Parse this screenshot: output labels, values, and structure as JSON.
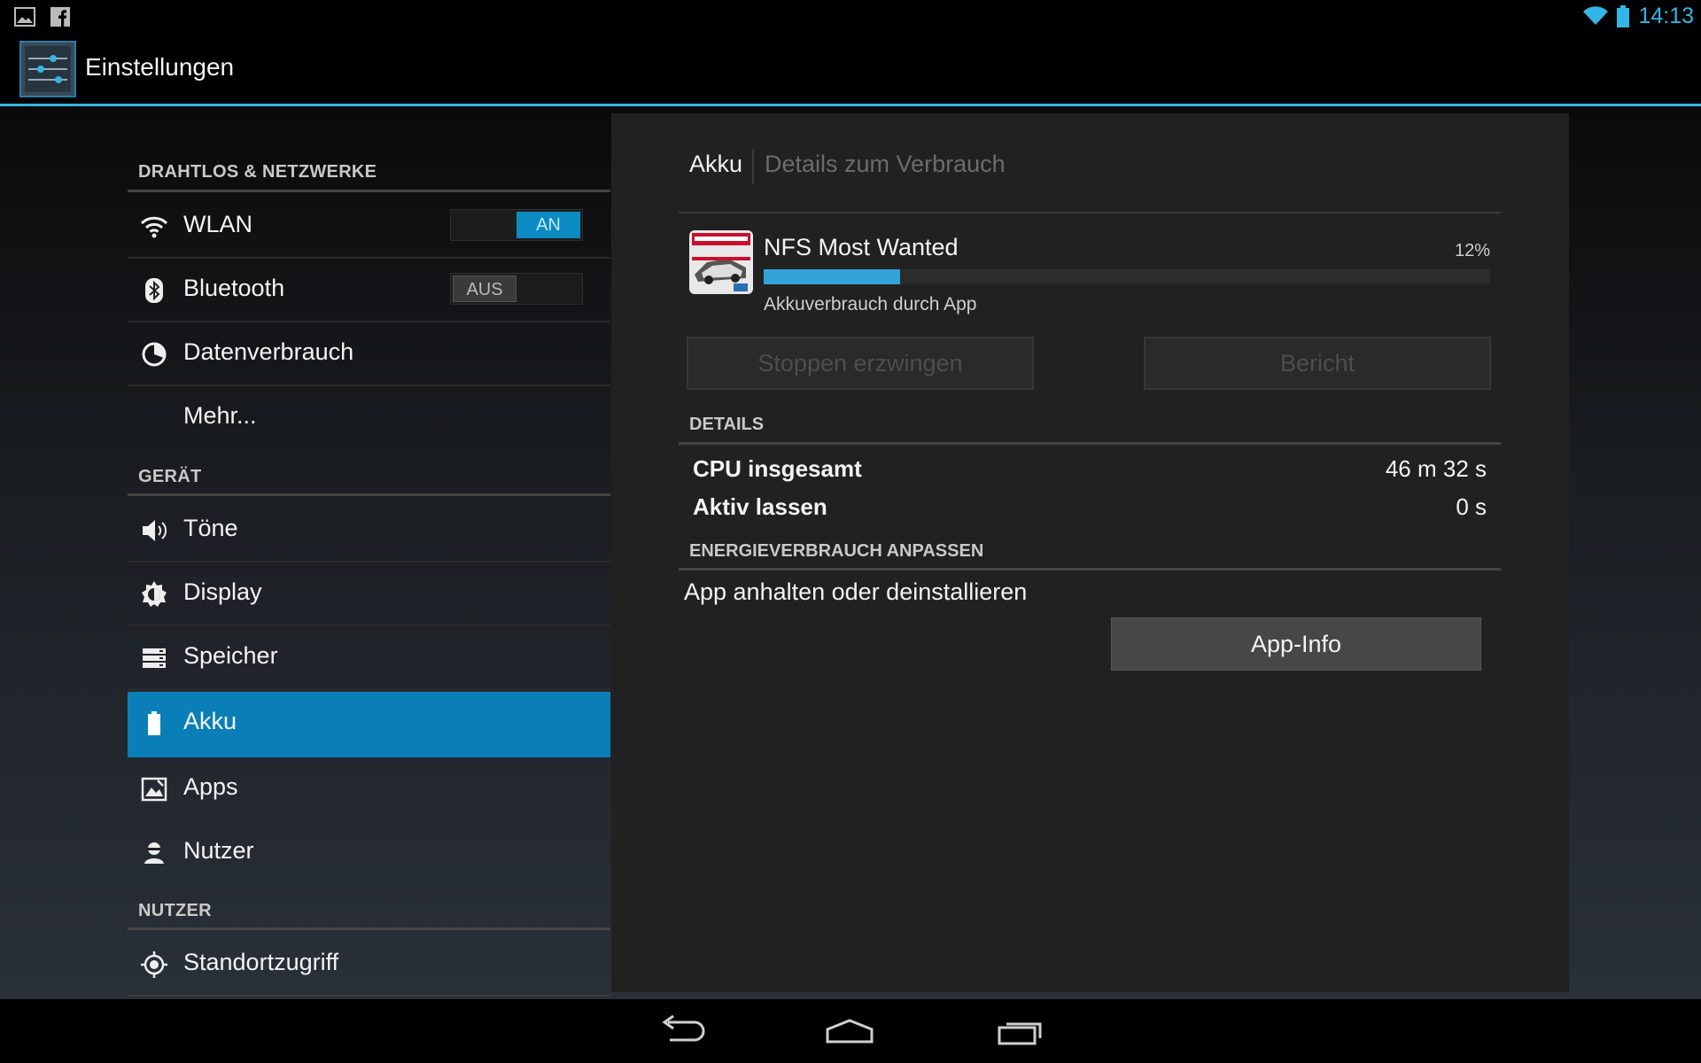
{
  "status_bar": {
    "time": "14:13",
    "icons": [
      "gallery-icon",
      "facebook-icon",
      "wifi-icon",
      "battery-icon"
    ]
  },
  "action_bar": {
    "title": "Einstellungen",
    "icon": "settings-sliders-icon",
    "accent_color": "#33b5e5"
  },
  "sidebar": {
    "sections": [
      {
        "header": "DRAHTLOS & NETZWERKE",
        "items": [
          {
            "label": "WLAN",
            "icon": "wifi-icon",
            "toggle": "AN",
            "toggle_on": true
          },
          {
            "label": "Bluetooth",
            "icon": "bluetooth-icon",
            "toggle": "AUS",
            "toggle_on": false
          },
          {
            "label": "Datenverbrauch",
            "icon": "data-usage-icon"
          },
          {
            "label": "Mehr..."
          }
        ]
      },
      {
        "header": "GERÄT",
        "items": [
          {
            "label": "Töne",
            "icon": "speaker-icon"
          },
          {
            "label": "Display",
            "icon": "brightness-icon"
          },
          {
            "label": "Speicher",
            "icon": "storage-icon"
          },
          {
            "label": "Akku",
            "icon": "battery-icon",
            "selected": true
          },
          {
            "label": "Apps",
            "icon": "apps-icon"
          },
          {
            "label": "Nutzer",
            "icon": "user-icon"
          }
        ]
      },
      {
        "header": "NUTZER",
        "items": [
          {
            "label": "Standortzugriff",
            "icon": "location-icon"
          }
        ]
      }
    ],
    "selected_color": "#0a7fb7"
  },
  "detail": {
    "breadcrumb": {
      "main": "Akku",
      "sub": "Details zum Verbrauch"
    },
    "app": {
      "name": "NFS Most Wanted",
      "percent_label": "12%",
      "usage_fraction": 0.188,
      "subtitle": "Akkuverbrauch durch App",
      "icon": "nfs-most-wanted-app-icon"
    },
    "buttons": {
      "force_stop": "Stoppen erzwingen",
      "report": "Bericht"
    },
    "details_header": "DETAILS",
    "details": [
      {
        "key": "CPU insgesamt",
        "value": "46 m 32 s"
      },
      {
        "key": "Aktiv lassen",
        "value": "0 s"
      }
    ],
    "energy_header": "ENERGIEVERBRAUCH ANPASSEN",
    "energy_text": "App anhalten oder deinstallieren",
    "app_info_button": "App-Info"
  },
  "nav_bar": {
    "icons": [
      "back-icon",
      "home-icon",
      "recents-icon"
    ]
  }
}
